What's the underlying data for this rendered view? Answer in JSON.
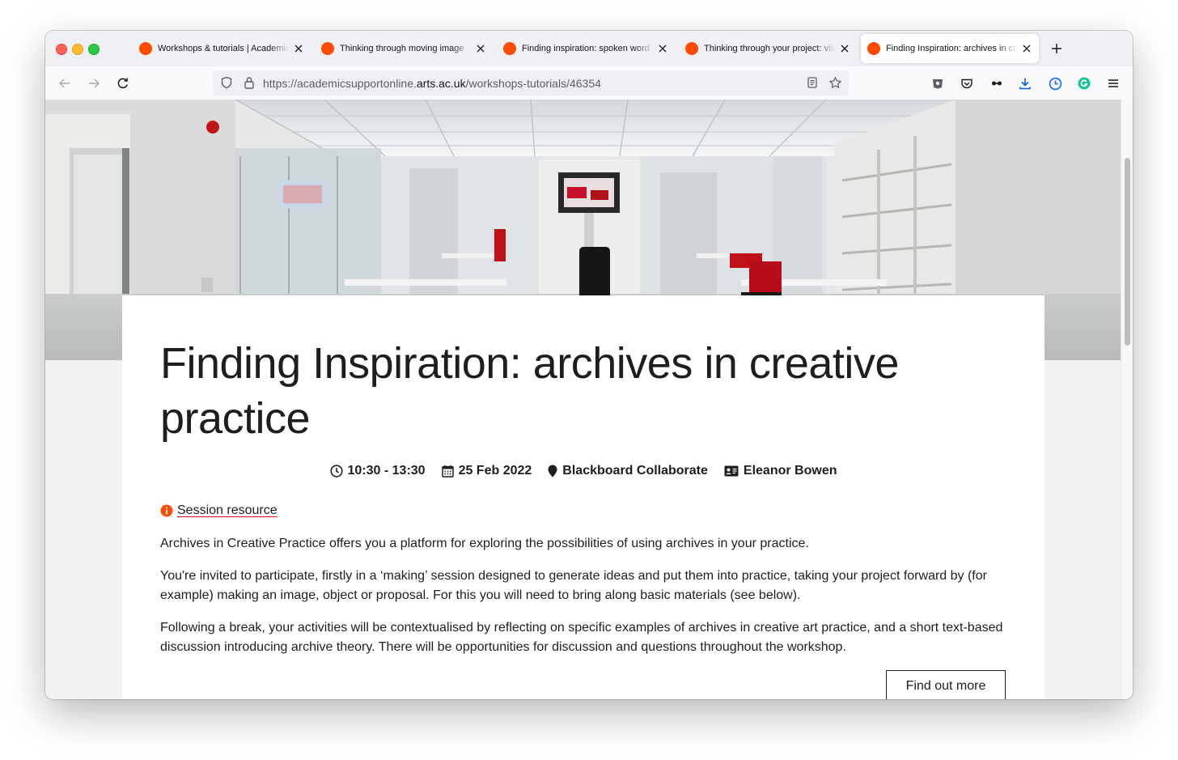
{
  "browser": {
    "tabs": [
      {
        "title": "Workshops & tutorials | Academic Support Online",
        "active": false
      },
      {
        "title": "Thinking through moving image",
        "active": false
      },
      {
        "title": "Finding inspiration: spoken word",
        "active": false
      },
      {
        "title": "Thinking through your project: visual",
        "active": false
      },
      {
        "title": "Finding Inspiration: archives in creative practice",
        "active": true
      }
    ],
    "url": {
      "prefix": "https://academicsupportonline.",
      "host": "arts.ac.uk",
      "path": "/workshops-tutorials/46354"
    },
    "accent_color": "#0060df"
  },
  "page": {
    "title": "Finding Inspiration: archives in creative practice",
    "meta": {
      "time": "10:30 - 13:30",
      "date": "25 Feb 2022",
      "location": "Blackboard Collaborate",
      "host": "Eleanor Bowen"
    },
    "resource_link": "Session resource",
    "paragraphs": [
      "Archives in Creative Practice offers you a platform for exploring the possibilities of using archives in your practice.",
      "You're invited to participate, firstly in a ‘making’ session designed to generate ideas and put them into practice, taking your project forward by (for example) making an image, object or proposal. For this you will need to bring along basic materials (see below).",
      "Following a break, your activities will be contextualised by reflecting on specific examples of archives in creative art practice, and a short text-based discussion introducing archive theory. There will be opportunities for discussion and questions throughout the workshop."
    ],
    "cta_label": "Find out more",
    "brand_color": "#e2001a",
    "info_icon_color": "#ff4a00"
  }
}
